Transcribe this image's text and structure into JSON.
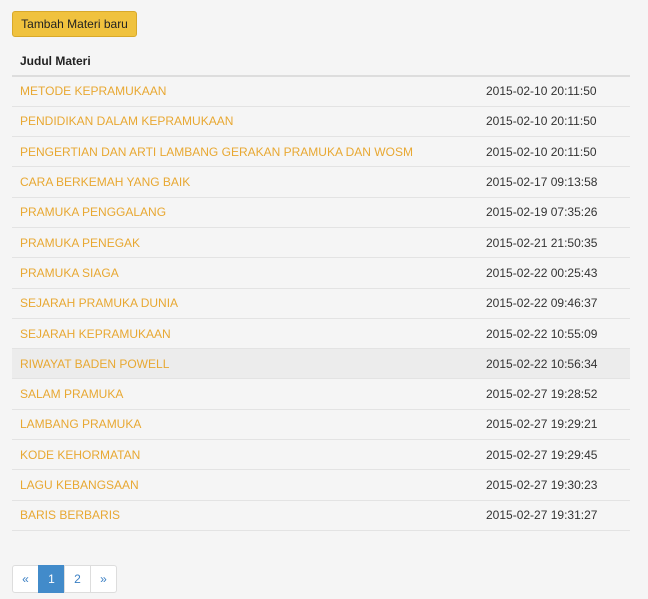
{
  "toolbar": {
    "add_label": "Tambah Materi baru"
  },
  "table": {
    "header": "Judul Materi",
    "rows": [
      {
        "title": "METODE KEPRAMUKAAN",
        "date": "2015-02-10 20:11:50"
      },
      {
        "title": "PENDIDIKAN DALAM KEPRAMUKAAN",
        "date": "2015-02-10 20:11:50"
      },
      {
        "title": "PENGERTIAN DAN ARTI LAMBANG GERAKAN PRAMUKA DAN WOSM",
        "date": "2015-02-10 20:11:50"
      },
      {
        "title": "CARA BERKEMAH YANG BAIK",
        "date": "2015-02-17 09:13:58"
      },
      {
        "title": "PRAMUKA PENGGALANG",
        "date": "2015-02-19 07:35:26"
      },
      {
        "title": "PRAMUKA PENEGAK",
        "date": "2015-02-21 21:50:35"
      },
      {
        "title": "PRAMUKA SIAGA",
        "date": "2015-02-22 00:25:43"
      },
      {
        "title": "SEJARAH PRAMUKA DUNIA",
        "date": "2015-02-22 09:46:37"
      },
      {
        "title": "SEJARAH KEPRAMUKAAN",
        "date": "2015-02-22 10:55:09"
      },
      {
        "title": "RIWAYAT BADEN POWELL",
        "date": "2015-02-22 10:56:34"
      },
      {
        "title": "SALAM PRAMUKA",
        "date": "2015-02-27 19:28:52"
      },
      {
        "title": "LAMBANG PRAMUKA",
        "date": "2015-02-27 19:29:21"
      },
      {
        "title": "KODE KEHORMATAN",
        "date": "2015-02-27 19:29:45"
      },
      {
        "title": "LAGU KEBANGSAAN",
        "date": "2015-02-27 19:30:23"
      },
      {
        "title": "BARIS BERBARIS",
        "date": "2015-02-27 19:31:27"
      }
    ]
  },
  "pagination": {
    "prev": "«",
    "pages": [
      "1",
      "2"
    ],
    "next": "»",
    "active": "1"
  },
  "colors": {
    "accent": "#f0c23e",
    "link": "#e8a832",
    "active_page": "#428bca"
  }
}
